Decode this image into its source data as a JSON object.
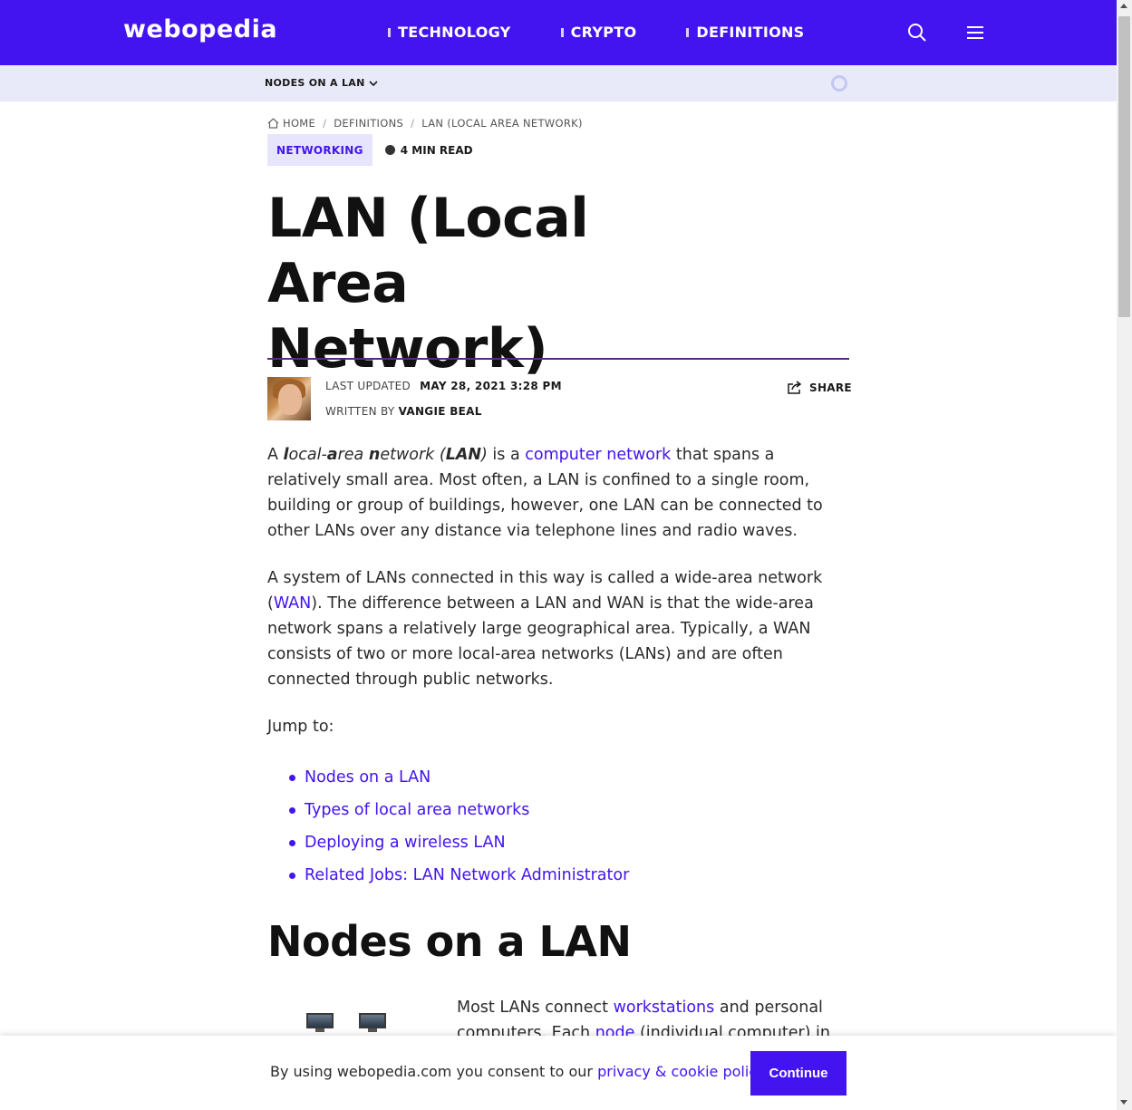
{
  "header": {
    "logo": "webopedia",
    "nav": [
      {
        "label": "TECHNOLOGY"
      },
      {
        "label": "CRYPTO"
      },
      {
        "label": "DEFINITIONS"
      }
    ]
  },
  "subbar": {
    "item": "NODES ON A LAN"
  },
  "breadcrumb": {
    "home": "HOME",
    "definitions": "DEFINITIONS",
    "current": "LAN (LOCAL AREA NETWORK)"
  },
  "article": {
    "tag": "NETWORKING",
    "read_time": "4 MIN READ",
    "title_line1": "LAN (Local Area",
    "title_line2": "Network)",
    "last_updated_label": "LAST UPDATED",
    "last_updated_value": "MAY 28, 2021 3:28 PM",
    "written_by_label": "WRITTEN BY",
    "author": "VANGIE BEAL",
    "share_label": "SHARE",
    "p1": {
      "a": "A ",
      "term_l": "l",
      "term_1": "ocal-",
      "term_a": "a",
      "term_2": "rea ",
      "term_n": "n",
      "term_3": "etwork (",
      "term_lan": "LAN",
      "term_4": ")",
      "b": " is a ",
      "link": "computer network",
      "c": " that spans a relatively small area. Most often, a LAN is confined to a single room, building or group of buildings, however, one LAN can be connected to other LANs over any distance via telephone lines and radio waves."
    },
    "p2": {
      "a": "A system of LANs connected in this way is called a wide-area network (",
      "link": "WAN",
      "b": "). The difference between a LAN and WAN is that the wide-area network spans a relatively large geographical area. Typically, a WAN consists of two or more local-area networks (LANs) and are often connected through public networks."
    },
    "jump_to": "Jump to:",
    "jump_links": [
      "Nodes on a LAN",
      "Types of local area networks",
      "Deploying a wireless LAN",
      "Related Jobs: LAN Network Administrator"
    ],
    "h2": "Nodes on a LAN",
    "p4": {
      "a": "Most LANs connect ",
      "link1": "workstations",
      "b": " and personal computers. Each ",
      "link2": "node",
      "c": " (individual computer) in a"
    }
  },
  "consent": {
    "text": "By using webopedia.com you consent to our ",
    "link": "privacy & cookie policy",
    "end": ".",
    "button": "Continue"
  },
  "colors": {
    "brand": "#4314f0",
    "subbar": "#e9eaf9",
    "tag_bg": "#e6e5fb"
  }
}
